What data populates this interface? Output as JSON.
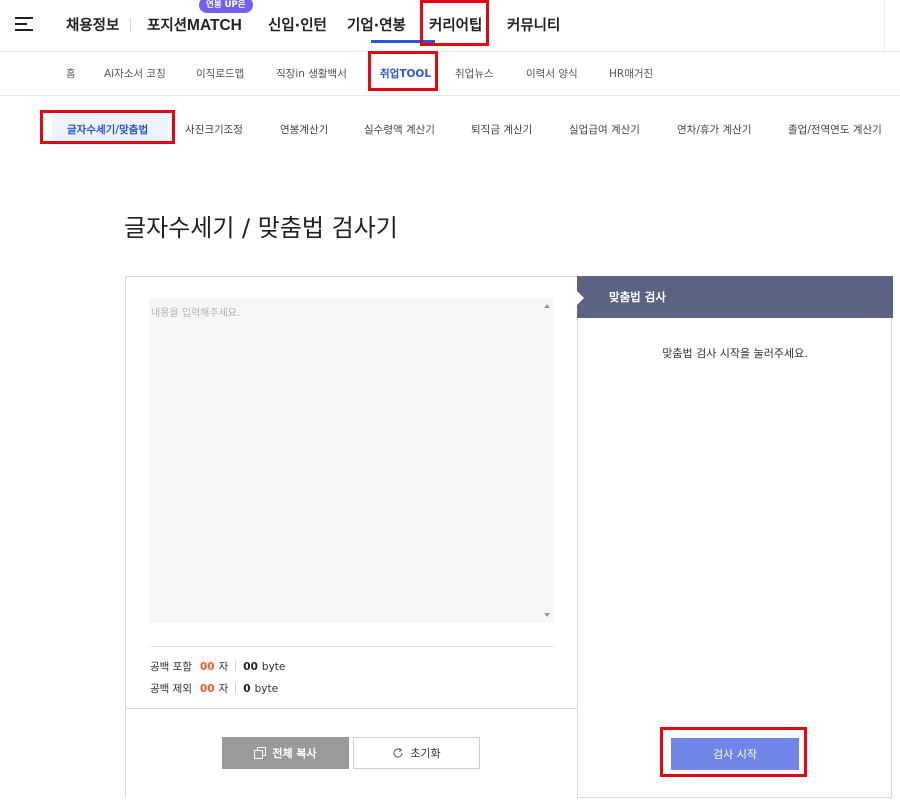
{
  "gnb": {
    "items": [
      "채용정보",
      "포지션",
      "MATCH",
      "신입·인턴",
      "기업·연봉",
      "커리어팁",
      "커뮤니티"
    ],
    "badge": "연봉 UP은"
  },
  "subnav": {
    "items": [
      "홈",
      "Ai자소서 코칭",
      "이직로드맵",
      "직장in 생활백서",
      "취업TOOL",
      "취업뉴스",
      "이력서 양식",
      "HR매거진"
    ],
    "active": "취업TOOL"
  },
  "tools": {
    "items": [
      "글자수세기/맞춤법",
      "사진크기조정",
      "연봉계산기",
      "실수령액 계산기",
      "퇴직금 계산기",
      "실업급여 계산기",
      "연차/휴가 계산기",
      "졸업/전역연도 계산기"
    ],
    "active": "글자수세기/맞춤법"
  },
  "page": {
    "title": "글자수세기 / 맞춤법 검사기"
  },
  "editor": {
    "placeholder": "내용을 입력해주세요.",
    "with_space_label": "공백 포함",
    "with_space_count": "00",
    "with_space_bytes": "00",
    "without_space_label": "공백 제외",
    "without_space_count": "00",
    "without_space_bytes": "0",
    "char_unit": "자",
    "byte_unit": "byte",
    "copy_label": "전체 복사",
    "reset_label": "초기화"
  },
  "spell": {
    "header": "맞춤법 검사",
    "message": "맞춤법 검사 시작을 눌러주세요.",
    "button": "검사 시작"
  },
  "colors": {
    "accent": "#2b55d8",
    "count_highlight": "#ff5a1e",
    "check_button": "#6f86e6",
    "spell_header": "#5c6382",
    "highlight_box": "#e30613"
  }
}
